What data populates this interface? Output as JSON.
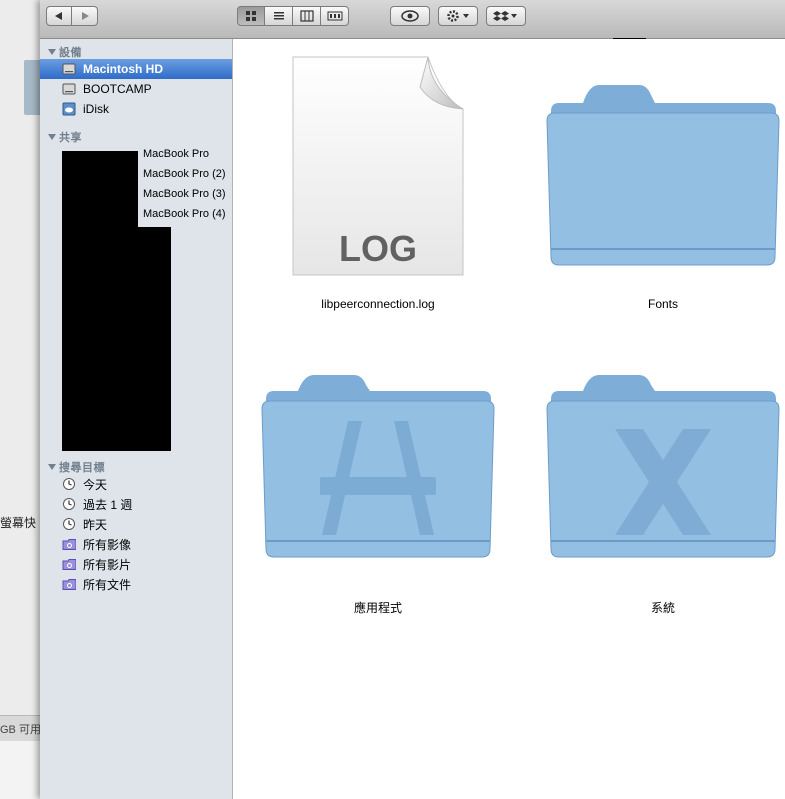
{
  "desktop": {
    "label": "螢幕快",
    "status_text": "GB 可用"
  },
  "toolbar": {
    "back_icon": "chevron-left-icon",
    "forward_icon": "chevron-right-icon",
    "view_modes": [
      "icon-view",
      "list-view",
      "column-view",
      "coverflow-view"
    ],
    "active_view": "icon-view",
    "quicklook_icon": "eye-icon",
    "action_icon": "gear-icon",
    "dropbox_icon": "dropbox-icon"
  },
  "sidebar": {
    "devices_header": "設備",
    "devices": [
      {
        "label": "Macintosh HD",
        "icon": "hard-drive-icon",
        "selected": true
      },
      {
        "label": "BOOTCAMP",
        "icon": "hard-drive-icon",
        "selected": false
      },
      {
        "label": "iDisk",
        "icon": "idisk-icon",
        "selected": false
      }
    ],
    "shared_header": "共享",
    "shared": [
      {
        "label": "MacBook Pro"
      },
      {
        "label": "MacBook Pro (2)"
      },
      {
        "label": "MacBook Pro (3)"
      },
      {
        "label": "MacBook Pro (4)"
      }
    ],
    "search_header": "搜尋目標",
    "search": [
      {
        "label": "今天",
        "icon": "clock-icon"
      },
      {
        "label": "過去 1 週",
        "icon": "clock-icon"
      },
      {
        "label": "昨天",
        "icon": "clock-icon"
      },
      {
        "label": "所有影像",
        "icon": "smart-folder-icon"
      },
      {
        "label": "所有影片",
        "icon": "smart-folder-icon"
      },
      {
        "label": "所有文件",
        "icon": "smart-folder-icon"
      }
    ]
  },
  "files": [
    {
      "name": "libpeerconnection.log",
      "type": "log-document",
      "badge": "LOG"
    },
    {
      "name": "Fonts",
      "type": "folder"
    },
    {
      "name": "應用程式",
      "type": "applications-folder"
    },
    {
      "name": "系統",
      "type": "system-folder"
    }
  ],
  "colors": {
    "folder_main": "#8fbbe0",
    "folder_dark": "#6fa0cc",
    "selection": "#3a75cf",
    "sidebar_bg": "#dee4ea"
  }
}
